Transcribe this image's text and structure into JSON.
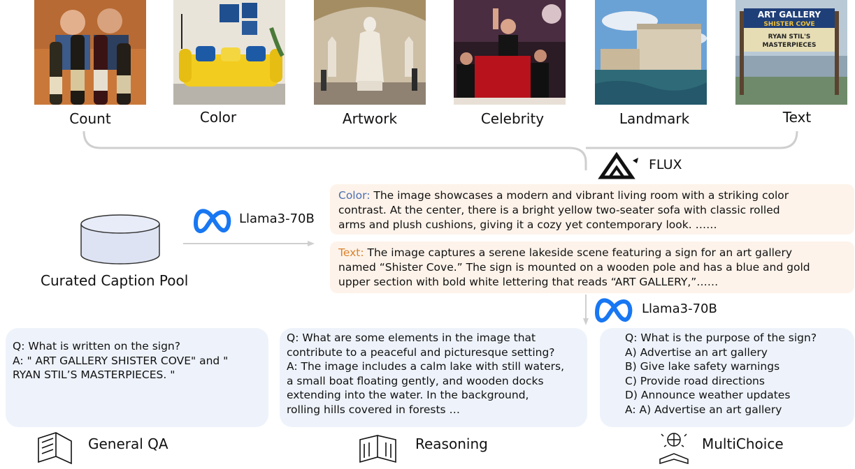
{
  "categories": [
    "Count",
    "Color",
    "Artwork",
    "Celebrity",
    "Landmark",
    "Text"
  ],
  "flux_label": "FLUX",
  "llama_label": "Llama3-70B",
  "pool_label": "Curated Caption Pool",
  "captions": {
    "color": {
      "label": "Color:",
      "lines": [
        " The image showcases a modern and vibrant living room with a striking color",
        "contrast. At the center, there is a bright yellow two-seater sofa with classic rolled",
        "arms and plush cushions, giving it a cozy yet contemporary look. ……"
      ]
    },
    "text": {
      "label": "Text:",
      "lines": [
        " The image captures a serene lakeside scene featuring a sign for an art gallery",
        "named “Shister Cove.” The sign is mounted on a wooden pole and has a blue and gold",
        "upper section with bold white lettering that reads “ART GALLERY,”……"
      ]
    }
  },
  "qa": {
    "general": [
      "Q: What is written on the sign?",
      "A: \" ART GALLERY SHISTER COVE\" and \"",
      "RYAN STIL’S MASTERPIECES. \""
    ],
    "reasoning": [
      "Q: What are some elements in the image that",
      "contribute to a peaceful and picturesque setting?",
      "A: The image includes a calm lake with still waters,",
      "a small boat floating gently, and wooden docks",
      "extending into the water. In the background,",
      "rolling hills covered in forests …"
    ],
    "multichoice": [
      "Q: What is the purpose of the sign?",
      "A) Advertise an art gallery",
      "B) Give lake safety warnings",
      "C) Provide road directions",
      "D) Announce weather updates",
      "A: A) Advertise an art gallery"
    ]
  },
  "sign_text": {
    "line1": "ART GALLERY",
    "line2": "SHISTER COVE",
    "line3": "RYAN STIL'S",
    "line4": "MASTERPIECES"
  },
  "footer": {
    "general": "General QA",
    "reasoning": "Reasoning",
    "multichoice": "MultiChoice"
  },
  "colors": {
    "caption_bg": "#fdf3ea",
    "qa_bg": "#eef3fb",
    "meta_blue": "#1877f2",
    "color_label": "#4a6fb3",
    "text_label": "#d9822b"
  }
}
